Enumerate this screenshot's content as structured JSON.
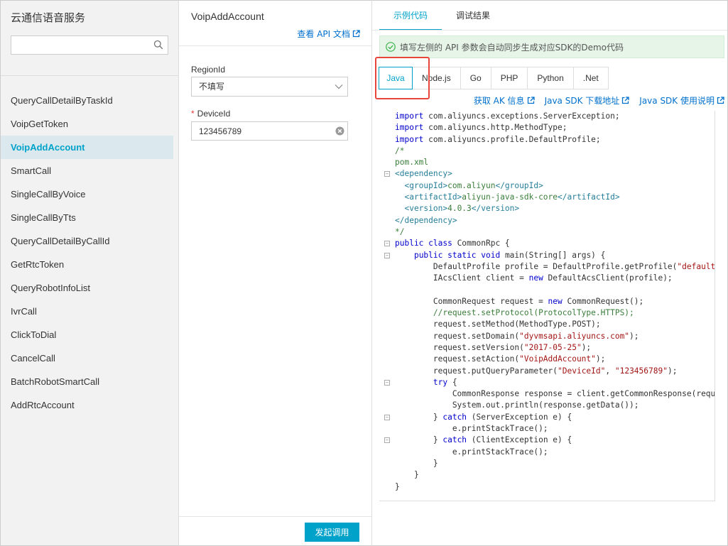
{
  "sidebar": {
    "title": "云通信语音服务",
    "search_placeholder": "",
    "items": [
      {
        "label": "QueryCallDetailByTaskId",
        "active": false
      },
      {
        "label": "VoipGetToken",
        "active": false
      },
      {
        "label": "VoipAddAccount",
        "active": true
      },
      {
        "label": "SmartCall",
        "active": false
      },
      {
        "label": "SingleCallByVoice",
        "active": false
      },
      {
        "label": "SingleCallByTts",
        "active": false
      },
      {
        "label": "QueryCallDetailByCallId",
        "active": false
      },
      {
        "label": "GetRtcToken",
        "active": false
      },
      {
        "label": "QueryRobotInfoList",
        "active": false
      },
      {
        "label": "IvrCall",
        "active": false
      },
      {
        "label": "ClickToDial",
        "active": false
      },
      {
        "label": "CancelCall",
        "active": false
      },
      {
        "label": "BatchRobotSmartCall",
        "active": false
      },
      {
        "label": "AddRtcAccount",
        "active": false
      }
    ]
  },
  "params": {
    "api_name": "VoipAddAccount",
    "doc_link": "查看 API 文档",
    "region": {
      "label": "RegionId",
      "value": "不填写"
    },
    "device": {
      "label": "DeviceId",
      "required_mark": "*",
      "value": "123456789"
    },
    "submit_label": "发起调用"
  },
  "code_panel": {
    "tabs": [
      "示例代码",
      "调试结果"
    ],
    "active_tab": 0,
    "notice": "填写左侧的 API 参数会自动同步生成对应SDK的Demo代码",
    "languages": [
      "Java",
      "Node.js",
      "Go",
      "PHP",
      "Python",
      ".Net"
    ],
    "active_language": 0,
    "links": [
      "获取 AK 信息",
      "Java SDK 下载地址",
      "Java SDK 使用说明"
    ],
    "code_lines": [
      {
        "fold": false,
        "parts": [
          [
            "kw",
            "import"
          ],
          [
            "plain",
            " com.aliyuncs.exceptions.ServerException;"
          ]
        ]
      },
      {
        "fold": false,
        "parts": [
          [
            "kw",
            "import"
          ],
          [
            "plain",
            " com.aliyuncs.http.MethodType;"
          ]
        ]
      },
      {
        "fold": false,
        "parts": [
          [
            "kw",
            "import"
          ],
          [
            "plain",
            " com.aliyuncs.profile.DefaultProfile;"
          ]
        ]
      },
      {
        "fold": false,
        "parts": [
          [
            "cm",
            "/*"
          ]
        ]
      },
      {
        "fold": false,
        "parts": [
          [
            "cm",
            "pom.xml"
          ]
        ]
      },
      {
        "fold": true,
        "parts": [
          [
            "tag",
            "<dependency>"
          ]
        ]
      },
      {
        "fold": false,
        "parts": [
          [
            "tag",
            "  <groupId>"
          ],
          [
            "cm",
            "com.aliyun"
          ],
          [
            "tag",
            "</groupId>"
          ]
        ]
      },
      {
        "fold": false,
        "parts": [
          [
            "tag",
            "  <artifactId>"
          ],
          [
            "cm",
            "aliyun-java-sdk-core"
          ],
          [
            "tag",
            "</artifactId>"
          ]
        ]
      },
      {
        "fold": false,
        "parts": [
          [
            "tag",
            "  <version>"
          ],
          [
            "cm",
            "4.0.3"
          ],
          [
            "tag",
            "</version>"
          ]
        ]
      },
      {
        "fold": false,
        "parts": [
          [
            "tag",
            "</dependency>"
          ]
        ]
      },
      {
        "fold": false,
        "parts": [
          [
            "cm",
            "*/"
          ]
        ]
      },
      {
        "fold": true,
        "parts": [
          [
            "kw",
            "public class"
          ],
          [
            "plain",
            " CommonRpc {"
          ]
        ]
      },
      {
        "fold": true,
        "parts": [
          [
            "plain",
            "    "
          ],
          [
            "kw",
            "public static void"
          ],
          [
            "plain",
            " main(String[] args) {"
          ]
        ]
      },
      {
        "fold": false,
        "parts": [
          [
            "plain",
            "        DefaultProfile profile = DefaultProfile.getProfile("
          ],
          [
            "str",
            "\"default\""
          ],
          [
            "plain",
            ","
          ]
        ]
      },
      {
        "fold": false,
        "parts": [
          [
            "plain",
            "        IAcsClient client = "
          ],
          [
            "kw",
            "new"
          ],
          [
            "plain",
            " DefaultAcsClient(profile);"
          ]
        ]
      },
      {
        "fold": false,
        "parts": [
          [
            "plain",
            ""
          ]
        ]
      },
      {
        "fold": false,
        "parts": [
          [
            "plain",
            "        CommonRequest request = "
          ],
          [
            "kw",
            "new"
          ],
          [
            "plain",
            " CommonRequest();"
          ]
        ]
      },
      {
        "fold": false,
        "parts": [
          [
            "cm",
            "        //request.setProtocol(ProtocolType.HTTPS);"
          ]
        ]
      },
      {
        "fold": false,
        "parts": [
          [
            "plain",
            "        request.setMethod(MethodType.POST);"
          ]
        ]
      },
      {
        "fold": false,
        "parts": [
          [
            "plain",
            "        request.setDomain("
          ],
          [
            "str",
            "\"dyvmsapi.aliyuncs.com\""
          ],
          [
            "plain",
            ");"
          ]
        ]
      },
      {
        "fold": false,
        "parts": [
          [
            "plain",
            "        request.setVersion("
          ],
          [
            "str",
            "\"2017-05-25\""
          ],
          [
            "plain",
            ");"
          ]
        ]
      },
      {
        "fold": false,
        "parts": [
          [
            "plain",
            "        request.setAction("
          ],
          [
            "str",
            "\"VoipAddAccount\""
          ],
          [
            "plain",
            ");"
          ]
        ]
      },
      {
        "fold": false,
        "parts": [
          [
            "plain",
            "        request.putQueryParameter("
          ],
          [
            "str",
            "\"DeviceId\""
          ],
          [
            "plain",
            ", "
          ],
          [
            "str",
            "\"123456789\""
          ],
          [
            "plain",
            ");"
          ]
        ]
      },
      {
        "fold": true,
        "parts": [
          [
            "plain",
            "        "
          ],
          [
            "kw",
            "try"
          ],
          [
            "plain",
            " {"
          ]
        ]
      },
      {
        "fold": false,
        "parts": [
          [
            "plain",
            "            CommonResponse response = client.getCommonResponse(request"
          ]
        ]
      },
      {
        "fold": false,
        "parts": [
          [
            "plain",
            "            System.out.println(response.getData());"
          ]
        ]
      },
      {
        "fold": true,
        "parts": [
          [
            "plain",
            "        } "
          ],
          [
            "kw",
            "catch"
          ],
          [
            "plain",
            " (ServerException e) {"
          ]
        ]
      },
      {
        "fold": false,
        "parts": [
          [
            "plain",
            "            e.printStackTrace();"
          ]
        ]
      },
      {
        "fold": true,
        "parts": [
          [
            "plain",
            "        } "
          ],
          [
            "kw",
            "catch"
          ],
          [
            "plain",
            " (ClientException e) {"
          ]
        ]
      },
      {
        "fold": false,
        "parts": [
          [
            "plain",
            "            e.printStackTrace();"
          ]
        ]
      },
      {
        "fold": false,
        "parts": [
          [
            "plain",
            "        }"
          ]
        ]
      },
      {
        "fold": false,
        "parts": [
          [
            "plain",
            "    }"
          ]
        ]
      },
      {
        "fold": false,
        "parts": [
          [
            "plain",
            "}"
          ]
        ]
      }
    ]
  },
  "colors": {
    "accent": "#00a2ca",
    "link": "#0070cc",
    "highlight": "#e8463c",
    "notice_bg": "#e6f5e8",
    "success": "#3bb34a"
  }
}
